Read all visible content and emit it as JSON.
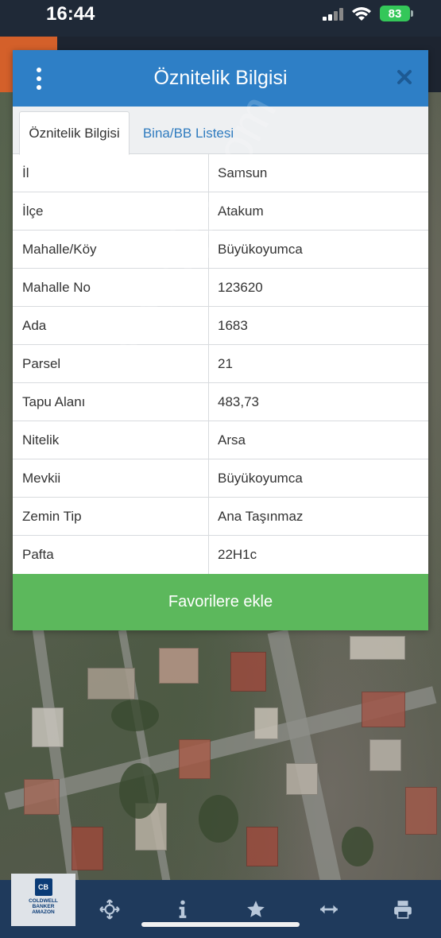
{
  "status_bar": {
    "time": "16:44",
    "battery": "83"
  },
  "dialog": {
    "title": "Öznitelik Bilgisi",
    "tabs": [
      {
        "label": "Öznitelik Bilgisi",
        "active": true
      },
      {
        "label": "Bina/BB Listesi",
        "active": false
      }
    ],
    "rows": [
      {
        "key": "İl",
        "value": "Samsun"
      },
      {
        "key": "İlçe",
        "value": "Atakum"
      },
      {
        "key": "Mahalle/Köy",
        "value": "Büyükoyumca"
      },
      {
        "key": "Mahalle No",
        "value": "123620"
      },
      {
        "key": "Ada",
        "value": "1683"
      },
      {
        "key": "Parsel",
        "value": "21"
      },
      {
        "key": "Tapu Alanı",
        "value": "483,73"
      },
      {
        "key": "Nitelik",
        "value": "Arsa"
      },
      {
        "key": "Mevkii",
        "value": "Büyükoyumca"
      },
      {
        "key": "Zemin Tip",
        "value": "Ana Taşınmaz"
      },
      {
        "key": "Pafta",
        "value": "22H1c"
      }
    ],
    "favorite_button": "Favorilere ekle"
  },
  "watermark": "emlakjet.com",
  "toolbar": {
    "logo": {
      "badge": "CB",
      "line1": "COLDWELL",
      "line2": "BANKER",
      "line3": "AMAZON"
    },
    "icons": [
      "move-icon",
      "info-icon",
      "star-icon",
      "measure-icon",
      "print-icon"
    ]
  },
  "colors": {
    "header": "#2e7fc6",
    "tab_link": "#2f7bbf",
    "favorite": "#5cb85c",
    "toolbar": "#1f3a5c",
    "battery": "#34c759"
  }
}
